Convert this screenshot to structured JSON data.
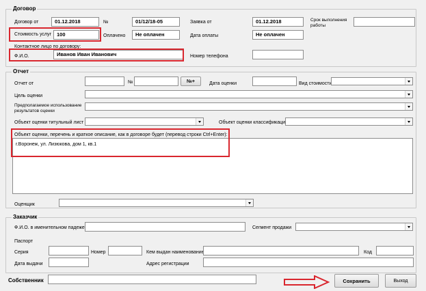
{
  "contract": {
    "legend": "Договор",
    "contract_from_label": "Договор от",
    "contract_date": "01.12.2018",
    "number_label": "№",
    "number": "01/12/18-05",
    "request_from_label": "Заявка от",
    "request_date": "01.12.2018",
    "deadline_label": "Срок выполнения работы",
    "deadline": "",
    "cost_label": "Стоимость услуг",
    "cost": "100",
    "paid_label": "Оплачено",
    "paid": "Не оплачен",
    "payment_date_label": "Дата оплаты",
    "payment_date": "Не оплачен",
    "contact_label": "Контактное лицо по договору:",
    "fio_label": "Ф.И.О.",
    "fio": "Иванов Иван Иванович",
    "phone_label": "Номер телефона",
    "phone": ""
  },
  "report": {
    "legend": "Отчет",
    "report_from_label": "Отчет от",
    "number_label": "№",
    "number_button": "№+",
    "eval_date_label": "Дата оценки",
    "value_type_label": "Вид стоимости",
    "purpose_label": "Цель оценки",
    "usage_label": "Предполагаемое использование результатов оценки",
    "title_object_label": "Объект оценки титульный лист",
    "classification_label": "Объект оценки классификация",
    "object_desc_label": "Объект оценки, перечень и краткое описание, как в договоре будет (перевод строки Ctrl+Enter):",
    "object_desc": "г.Воронеж, ул. Лизюкова, дом 1, кв.1",
    "appraiser_label": "Оценщик"
  },
  "customer": {
    "legend": "Заказчик",
    "fio_label": "Ф.И.О. в именительном падеже",
    "segment_label": "Сегмент продажи",
    "passport_label": "Паспорт",
    "series_label": "Серия",
    "number_label": "Номер",
    "issued_by_label": "Кем выдан наименование",
    "code_label": "Код",
    "issue_date_label": "Дата выдачи",
    "address_label": "Адрес регистрации"
  },
  "footer": {
    "owner_label": "Собственник",
    "save_label": "Сохранить",
    "exit_label": "Выход"
  },
  "colors": {
    "highlight": "#d9262e",
    "background": "#f0f0f0"
  }
}
